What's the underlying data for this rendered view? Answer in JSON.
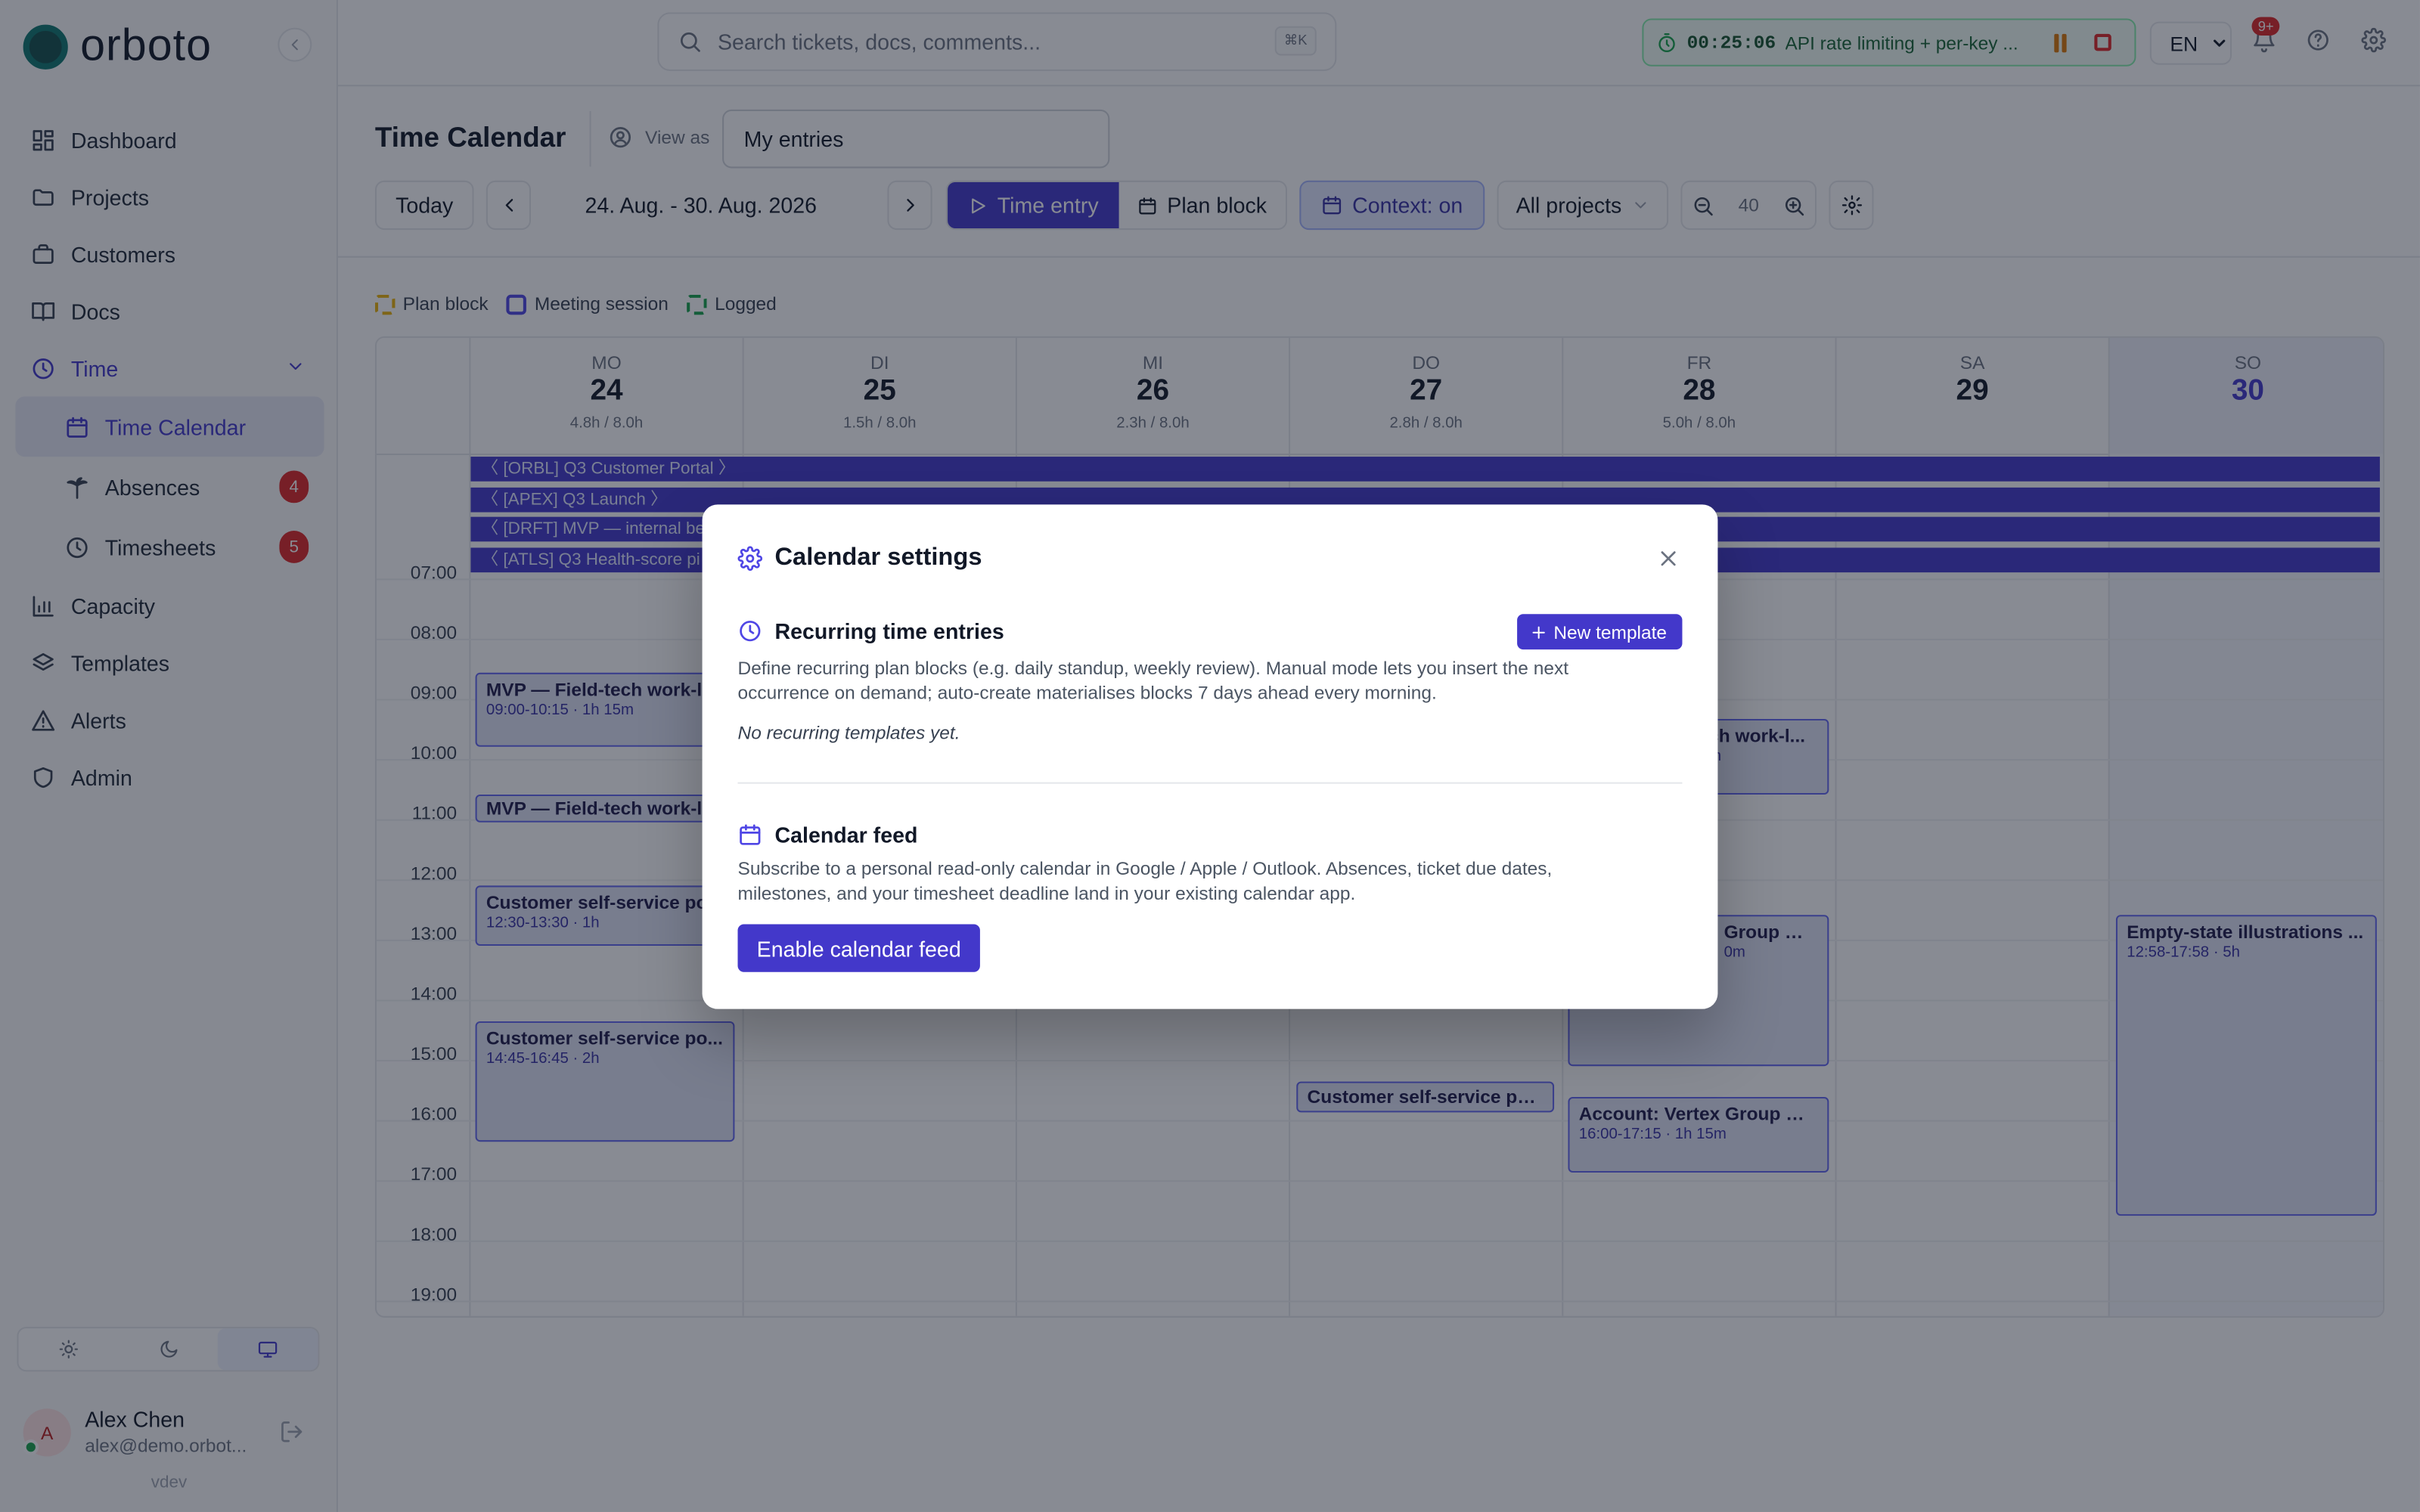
{
  "app": {
    "logo_text": "orboto",
    "version": "vdev"
  },
  "sidebar": {
    "items": [
      {
        "label": "Dashboard",
        "icon": "dashboard-icon"
      },
      {
        "label": "Projects",
        "icon": "folder-icon"
      },
      {
        "label": "Customers",
        "icon": "customers-icon"
      },
      {
        "label": "Docs",
        "icon": "book-icon"
      },
      {
        "label": "Time",
        "icon": "clock-icon"
      },
      {
        "label": "Time Calendar",
        "icon": "calendar-icon"
      },
      {
        "label": "Absences",
        "icon": "palm-tree-icon",
        "badge": "4"
      },
      {
        "label": "Timesheets",
        "icon": "clock-icon",
        "badge": "5"
      },
      {
        "label": "Capacity",
        "icon": "bar-chart-icon"
      },
      {
        "label": "Templates",
        "icon": "layers-icon"
      },
      {
        "label": "Alerts",
        "icon": "alert-triangle-icon"
      },
      {
        "label": "Admin",
        "icon": "shield-icon"
      }
    ],
    "user": {
      "initial": "A",
      "name": "Alex Chen",
      "email": "alex@demo.orbot..."
    }
  },
  "topbar": {
    "search_placeholder": "Search tickets, docs, comments...",
    "search_shortcut": "⌘K",
    "timer_time": "00:25:06",
    "timer_task": "API rate limiting + per-key ...",
    "language": "EN",
    "notifications_badge": "9+"
  },
  "page": {
    "title": "Time Calendar",
    "view_as_label": "View as",
    "view_as_value": "My entries",
    "today_label": "Today",
    "date_range": "24. Aug. - 30. Aug. 2026",
    "mode_time_entry": "Time entry",
    "mode_plan_block": "Plan block",
    "context_label": "Context: on",
    "projects_filter": "All projects",
    "zoom_value": "40"
  },
  "legend": {
    "plan_block": "Plan block",
    "meeting_session": "Meeting session",
    "logged": "Logged"
  },
  "colors": {
    "accent": "#4338ca",
    "timer_green": "#16a34a",
    "badge_red": "#dc2626",
    "plan_block": "#eab308",
    "meeting": "#4f46e5",
    "logged": "#16a34a"
  },
  "calendar": {
    "days": [
      {
        "name": "MO",
        "num": "24",
        "hours": "4.8h / 8.0h"
      },
      {
        "name": "DI",
        "num": "25",
        "hours": "1.5h / 8.0h"
      },
      {
        "name": "MI",
        "num": "26",
        "hours": "2.3h / 8.0h"
      },
      {
        "name": "DO",
        "num": "27",
        "hours": "2.8h / 8.0h"
      },
      {
        "name": "FR",
        "num": "28",
        "hours": "5.0h / 8.0h"
      },
      {
        "name": "SA",
        "num": "29",
        "hours": ""
      },
      {
        "name": "SO",
        "num": "30",
        "hours": ""
      }
    ],
    "banners": [
      "〈 [ORBL] Q3 Customer Portal 〉",
      "〈 [APEX] Q3 Launch 〉",
      "〈 [DRFT] MVP — internal beta",
      "〈 [ATLS] Q3 Health-score pi"
    ],
    "hours": [
      "07:00",
      "08:00",
      "09:00",
      "10:00",
      "11:00",
      "12:00",
      "13:00",
      "14:00",
      "15:00",
      "16:00",
      "17:00",
      "18:00",
      "19:00"
    ],
    "events": [
      {
        "title": "MVP — Field-tech work-l...",
        "sub": "09:00-10:15 · 1h 15m"
      },
      {
        "title": "MVP — Field-tech work-l...",
        "sub": ""
      },
      {
        "title": "Customer self-service po...",
        "sub": "12:30-13:30 · 1h"
      },
      {
        "title": "Customer self-service po...",
        "sub": "14:45-16:45 · 2h"
      },
      {
        "title": "Customer self-service po...",
        "sub": ""
      },
      {
        "title": "ch work-l...",
        "sub": "m"
      },
      {
        "title": "Group —...",
        "sub": "0m"
      },
      {
        "title": "Account: Vertex Group —...",
        "sub": "16:00-17:15 · 1h 15m"
      },
      {
        "title": "Empty-state illustrations ...",
        "sub": "12:58-17:58 · 5h"
      }
    ]
  },
  "modal": {
    "title": "Calendar settings",
    "recurring_title": "Recurring time entries",
    "new_template_label": "New template",
    "recurring_desc": "Define recurring plan blocks (e.g. daily standup, weekly review). Manual mode lets you insert the next occurrence on demand; auto-create materialises blocks 7 days ahead every morning.",
    "recurring_empty": "No recurring templates yet.",
    "feed_title": "Calendar feed",
    "feed_desc": "Subscribe to a personal read-only calendar in Google / Apple / Outlook. Absences, ticket due dates, milestones, and your timesheet deadline land in your existing calendar app.",
    "enable_feed_label": "Enable calendar feed"
  }
}
